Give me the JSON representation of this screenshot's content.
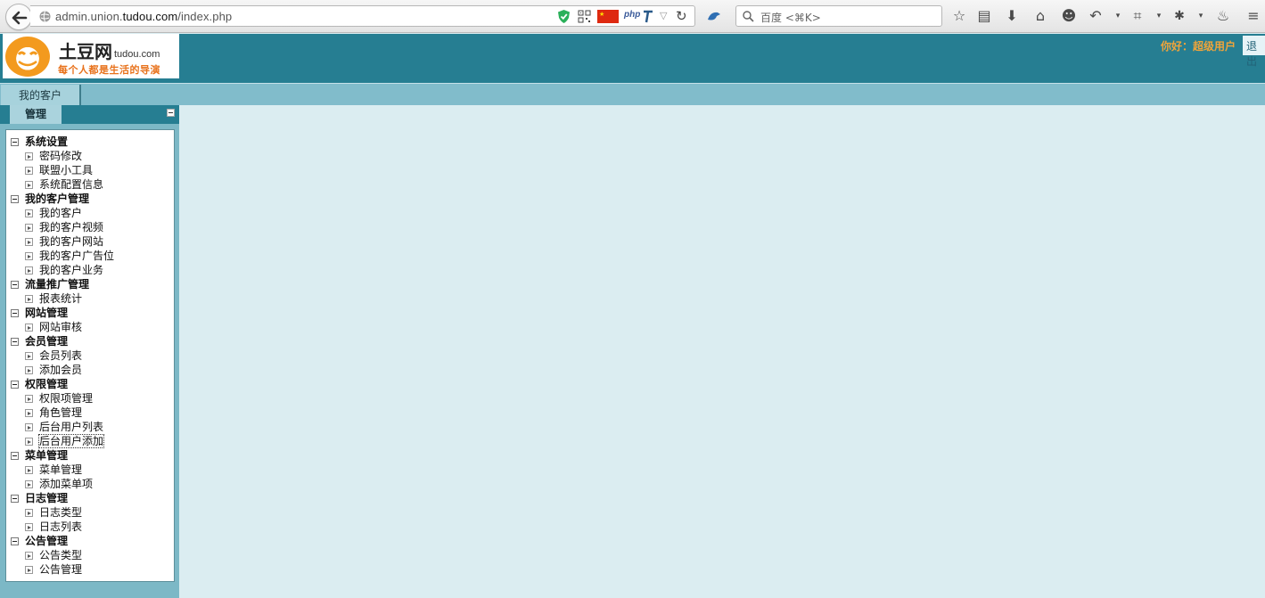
{
  "browser": {
    "url_prefix": "admin.union.",
    "url_domain": "tudou.com",
    "url_suffix": "/index.php",
    "php_badge": "php",
    "search_placeholder": "百度 <⌘K>"
  },
  "header": {
    "logo_title": "土豆网",
    "logo_domain": "tudou.com",
    "logo_slogan": "每个人都是生活的导演",
    "greeting": "你好：超级用户",
    "logout": "退出"
  },
  "tabs": [
    {
      "label": "我的客户"
    }
  ],
  "sidebar": {
    "tab_label": "管理",
    "groups": [
      {
        "label": "系统设置",
        "items": [
          "密码修改",
          "联盟小工具",
          "系统配置信息"
        ]
      },
      {
        "label": "我的客户管理",
        "items": [
          "我的客户",
          "我的客户视频",
          "我的客户网站",
          "我的客户广告位",
          "我的客户业务"
        ]
      },
      {
        "label": "流量推广管理",
        "items": [
          "报表统计"
        ]
      },
      {
        "label": "网站管理",
        "items": [
          "网站审核"
        ]
      },
      {
        "label": "会员管理",
        "items": [
          "会员列表",
          "添加会员"
        ]
      },
      {
        "label": "权限管理",
        "items": [
          "权限项管理",
          "角色管理",
          "后台用户列表",
          "后台用户添加"
        ]
      },
      {
        "label": "菜单管理",
        "items": [
          "菜单管理",
          "添加菜单项"
        ]
      },
      {
        "label": "日志管理",
        "items": [
          "日志类型",
          "日志列表"
        ]
      },
      {
        "label": "公告管理",
        "items": [
          "公告类型",
          "公告管理"
        ]
      }
    ],
    "focused_item": "后台用户添加"
  },
  "colors": {
    "header_bg": "#267e92",
    "tab_strip_bg": "#81bccb",
    "content_bg": "#dbedf1",
    "greeting": "#f0a43a",
    "logo_orange": "#e8721c"
  }
}
